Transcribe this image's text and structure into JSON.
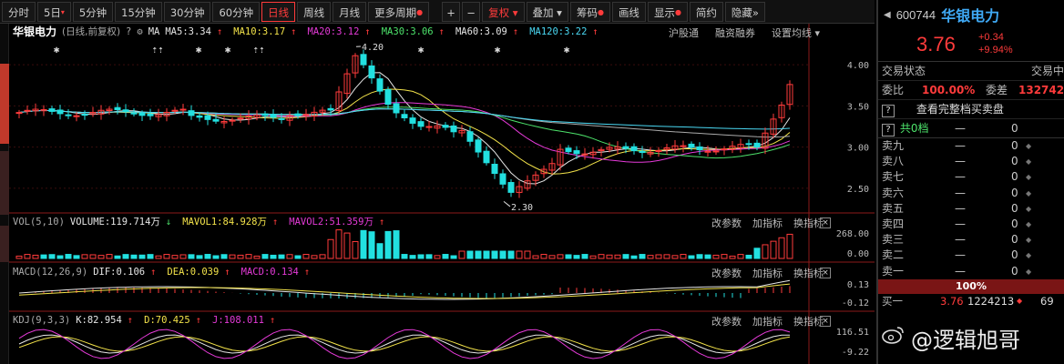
{
  "toolbar": {
    "items": [
      {
        "label": "分时",
        "state": "normal"
      },
      {
        "label": "5日",
        "state": "dropdown"
      },
      {
        "label": "5分钟",
        "state": "normal"
      },
      {
        "label": "15分钟",
        "state": "normal"
      },
      {
        "label": "30分钟",
        "state": "normal"
      },
      {
        "label": "60分钟",
        "state": "normal"
      },
      {
        "label": "日线",
        "state": "active"
      },
      {
        "label": "周线",
        "state": "normal"
      },
      {
        "label": "月线",
        "state": "normal"
      },
      {
        "label": "更多周期",
        "state": "dropdown"
      }
    ],
    "plus": "+",
    "minus": "−",
    "right_items": [
      "复权",
      "叠加",
      "筹码",
      "画线",
      "显示",
      "简约",
      "隐藏"
    ],
    "more": "»"
  },
  "chart": {
    "stock_name": "华银电力",
    "period_info": "(日线,前复权)",
    "ma_label": "MA",
    "ma": [
      {
        "label": "MA5:3.34",
        "dir": "up",
        "color": "#e6e6e6"
      },
      {
        "label": "MA10:3.17",
        "dir": "up",
        "color": "#f3e34a"
      },
      {
        "label": "MA20:3.12",
        "dir": "up",
        "color": "#e63ad9"
      },
      {
        "label": "MA30:3.06",
        "dir": "up",
        "color": "#4de36b"
      },
      {
        "label": "MA60:3.09",
        "dir": "up",
        "color": "#aaaaaa"
      },
      {
        "label": "MA120:3.22",
        "dir": "up",
        "color": "#4ad8f3"
      }
    ],
    "links": [
      "沪股通",
      "融资融券",
      "设置均线"
    ],
    "y_ticks": [
      "4.00",
      "3.50",
      "3.00",
      "2.50"
    ],
    "high_label": "4.20",
    "low_label": "2.30",
    "vol": {
      "title": "VOL(5,10)",
      "volume": "VOLUME:119.714万",
      "mavol1": "MAVOL1:84.928万",
      "mavol2": "MAVOL2:51.359万",
      "y_ticks": [
        "268.00",
        "0.00"
      ]
    },
    "macd": {
      "title": "MACD(12,26,9)",
      "dif": "DIF:0.106",
      "dea": "DEA:0.039",
      "macd": "MACD:0.134",
      "y_ticks": [
        "0.13",
        "-0.12"
      ]
    },
    "kdj": {
      "title": "KDJ(9,3,3)",
      "k": "K:82.954",
      "d": "D:70.425",
      "j": "J:108.011",
      "y_ticks": [
        "116.51",
        "-9.22"
      ]
    },
    "sub_links": [
      "改参数",
      "加指标",
      "换指标"
    ],
    "close": "×"
  },
  "chart_data": {
    "type": "candlestick",
    "title": "华银电力",
    "y_range": [
      2.2,
      4.3
    ],
    "high": 4.2,
    "low": 2.3,
    "last_close": 3.76,
    "series": [
      {
        "name": "MA5",
        "value": 3.34
      },
      {
        "name": "MA10",
        "value": 3.17
      },
      {
        "name": "MA20",
        "value": 3.12
      },
      {
        "name": "MA30",
        "value": 3.06
      },
      {
        "name": "MA60",
        "value": 3.09
      },
      {
        "name": "MA120",
        "value": 3.22
      }
    ]
  },
  "quote": {
    "code": "600744",
    "name": "华银电力",
    "price": "3.76",
    "change": "+0.34",
    "change_pct": "+9.94%",
    "status_label": "交易状态",
    "status_value": "交易中",
    "ratio_label": "委比",
    "ratio_value": "100.00%",
    "diff_label": "委差",
    "diff_value": "132742",
    "full_book": "查看完整档买卖盘",
    "level0_label": "共0档",
    "level0_dash": "—",
    "level0_value": "0",
    "asks": [
      {
        "label": "卖九",
        "price": "—",
        "vol": "0"
      },
      {
        "label": "卖八",
        "price": "—",
        "vol": "0"
      },
      {
        "label": "卖七",
        "price": "—",
        "vol": "0"
      },
      {
        "label": "卖六",
        "price": "—",
        "vol": "0"
      },
      {
        "label": "卖五",
        "price": "—",
        "vol": "0"
      },
      {
        "label": "卖四",
        "price": "—",
        "vol": "0"
      },
      {
        "label": "卖三",
        "price": "—",
        "vol": "0"
      },
      {
        "label": "卖二",
        "price": "—",
        "vol": "0"
      },
      {
        "label": "卖一",
        "price": "—",
        "vol": "0"
      }
    ],
    "pct_bar": "100%",
    "bids": [
      {
        "label": "买一",
        "price": "3.76",
        "vol": "1224213",
        "extra": "69"
      }
    ]
  },
  "watermark": {
    "text": "@逻辑旭哥"
  },
  "colors": {
    "up": "#ff3b3b",
    "down": "#22e0e0",
    "accent": "#3fa9f5"
  }
}
